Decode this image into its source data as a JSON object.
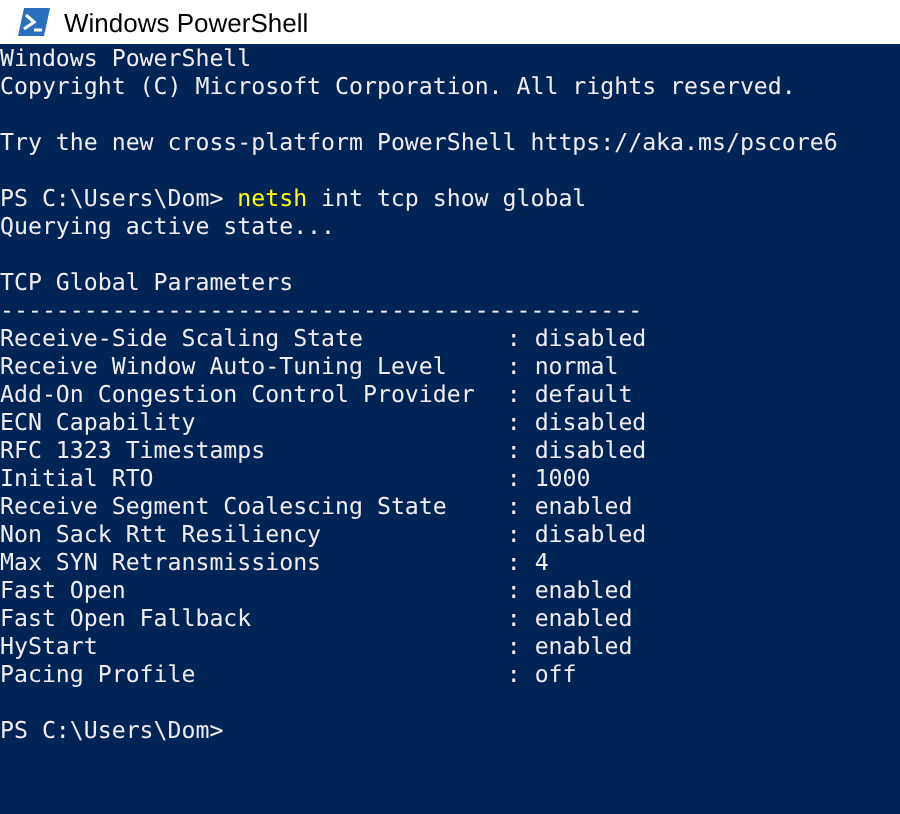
{
  "window": {
    "title": "Windows PowerShell"
  },
  "lines": [
    {
      "kind": "text",
      "text": "Windows PowerShell"
    },
    {
      "kind": "text",
      "text": "Copyright (C) Microsoft Corporation. All rights reserved."
    },
    {
      "kind": "blank"
    },
    {
      "kind": "text",
      "text": "Try the new cross-platform PowerShell https://aka.ms/pscore6"
    },
    {
      "kind": "blank"
    },
    {
      "kind": "prompt",
      "prompt": "PS C:\\Users\\Dom>",
      "command": "netsh",
      "args": "int tcp show global"
    },
    {
      "kind": "text",
      "text": "Querying active state..."
    },
    {
      "kind": "blank"
    },
    {
      "kind": "text",
      "text": "TCP Global Parameters"
    },
    {
      "kind": "text",
      "text": "----------------------------------------------"
    },
    {
      "kind": "param",
      "name": "Receive-Side Scaling State",
      "separator": ":",
      "value": "disabled"
    },
    {
      "kind": "param",
      "name": "Receive Window Auto-Tuning Level",
      "separator": ":",
      "value": "normal"
    },
    {
      "kind": "param",
      "name": "Add-On Congestion Control Provider",
      "separator": ":",
      "value": "default"
    },
    {
      "kind": "param",
      "name": "ECN Capability",
      "separator": ":",
      "value": "disabled"
    },
    {
      "kind": "param",
      "name": "RFC 1323 Timestamps",
      "separator": ":",
      "value": "disabled"
    },
    {
      "kind": "param",
      "name": "Initial RTO",
      "separator": ":",
      "value": "1000"
    },
    {
      "kind": "param",
      "name": "Receive Segment Coalescing State",
      "separator": ":",
      "value": "enabled"
    },
    {
      "kind": "param",
      "name": "Non Sack Rtt Resiliency",
      "separator": ":",
      "value": "disabled"
    },
    {
      "kind": "param",
      "name": "Max SYN Retransmissions",
      "separator": ":",
      "value": "4"
    },
    {
      "kind": "param",
      "name": "Fast Open",
      "separator": ":",
      "value": "enabled"
    },
    {
      "kind": "param",
      "name": "Fast Open Fallback",
      "separator": ":",
      "value": "enabled"
    },
    {
      "kind": "param",
      "name": "HyStart",
      "separator": ":",
      "value": "enabled"
    },
    {
      "kind": "param",
      "name": "Pacing Profile",
      "separator": ":",
      "value": "off"
    },
    {
      "kind": "blank"
    },
    {
      "kind": "prompt",
      "prompt": "PS C:\\Users\\Dom>"
    }
  ]
}
